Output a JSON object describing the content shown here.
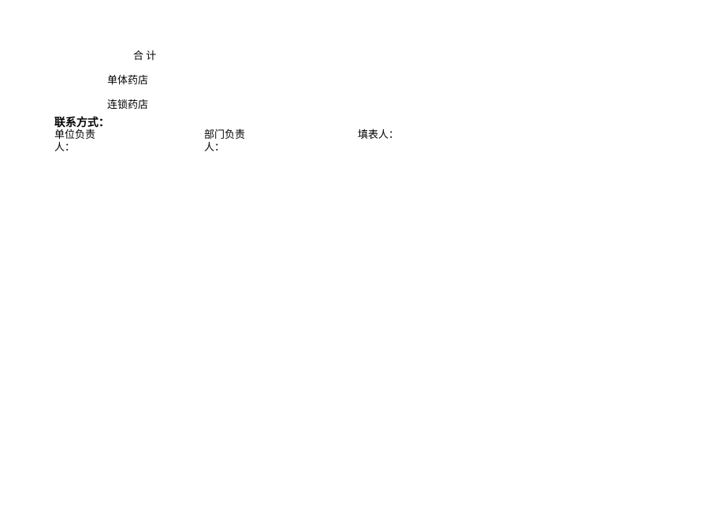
{
  "rows": {
    "total": "合 计",
    "single_pharmacy": "单体药店",
    "chain_pharmacy": "连锁药店"
  },
  "contact_label": "联系方式：",
  "signatures": {
    "unit_leader": "单位负责人：",
    "dept_leader": "部门负责人：",
    "form_filler": "填表人："
  }
}
